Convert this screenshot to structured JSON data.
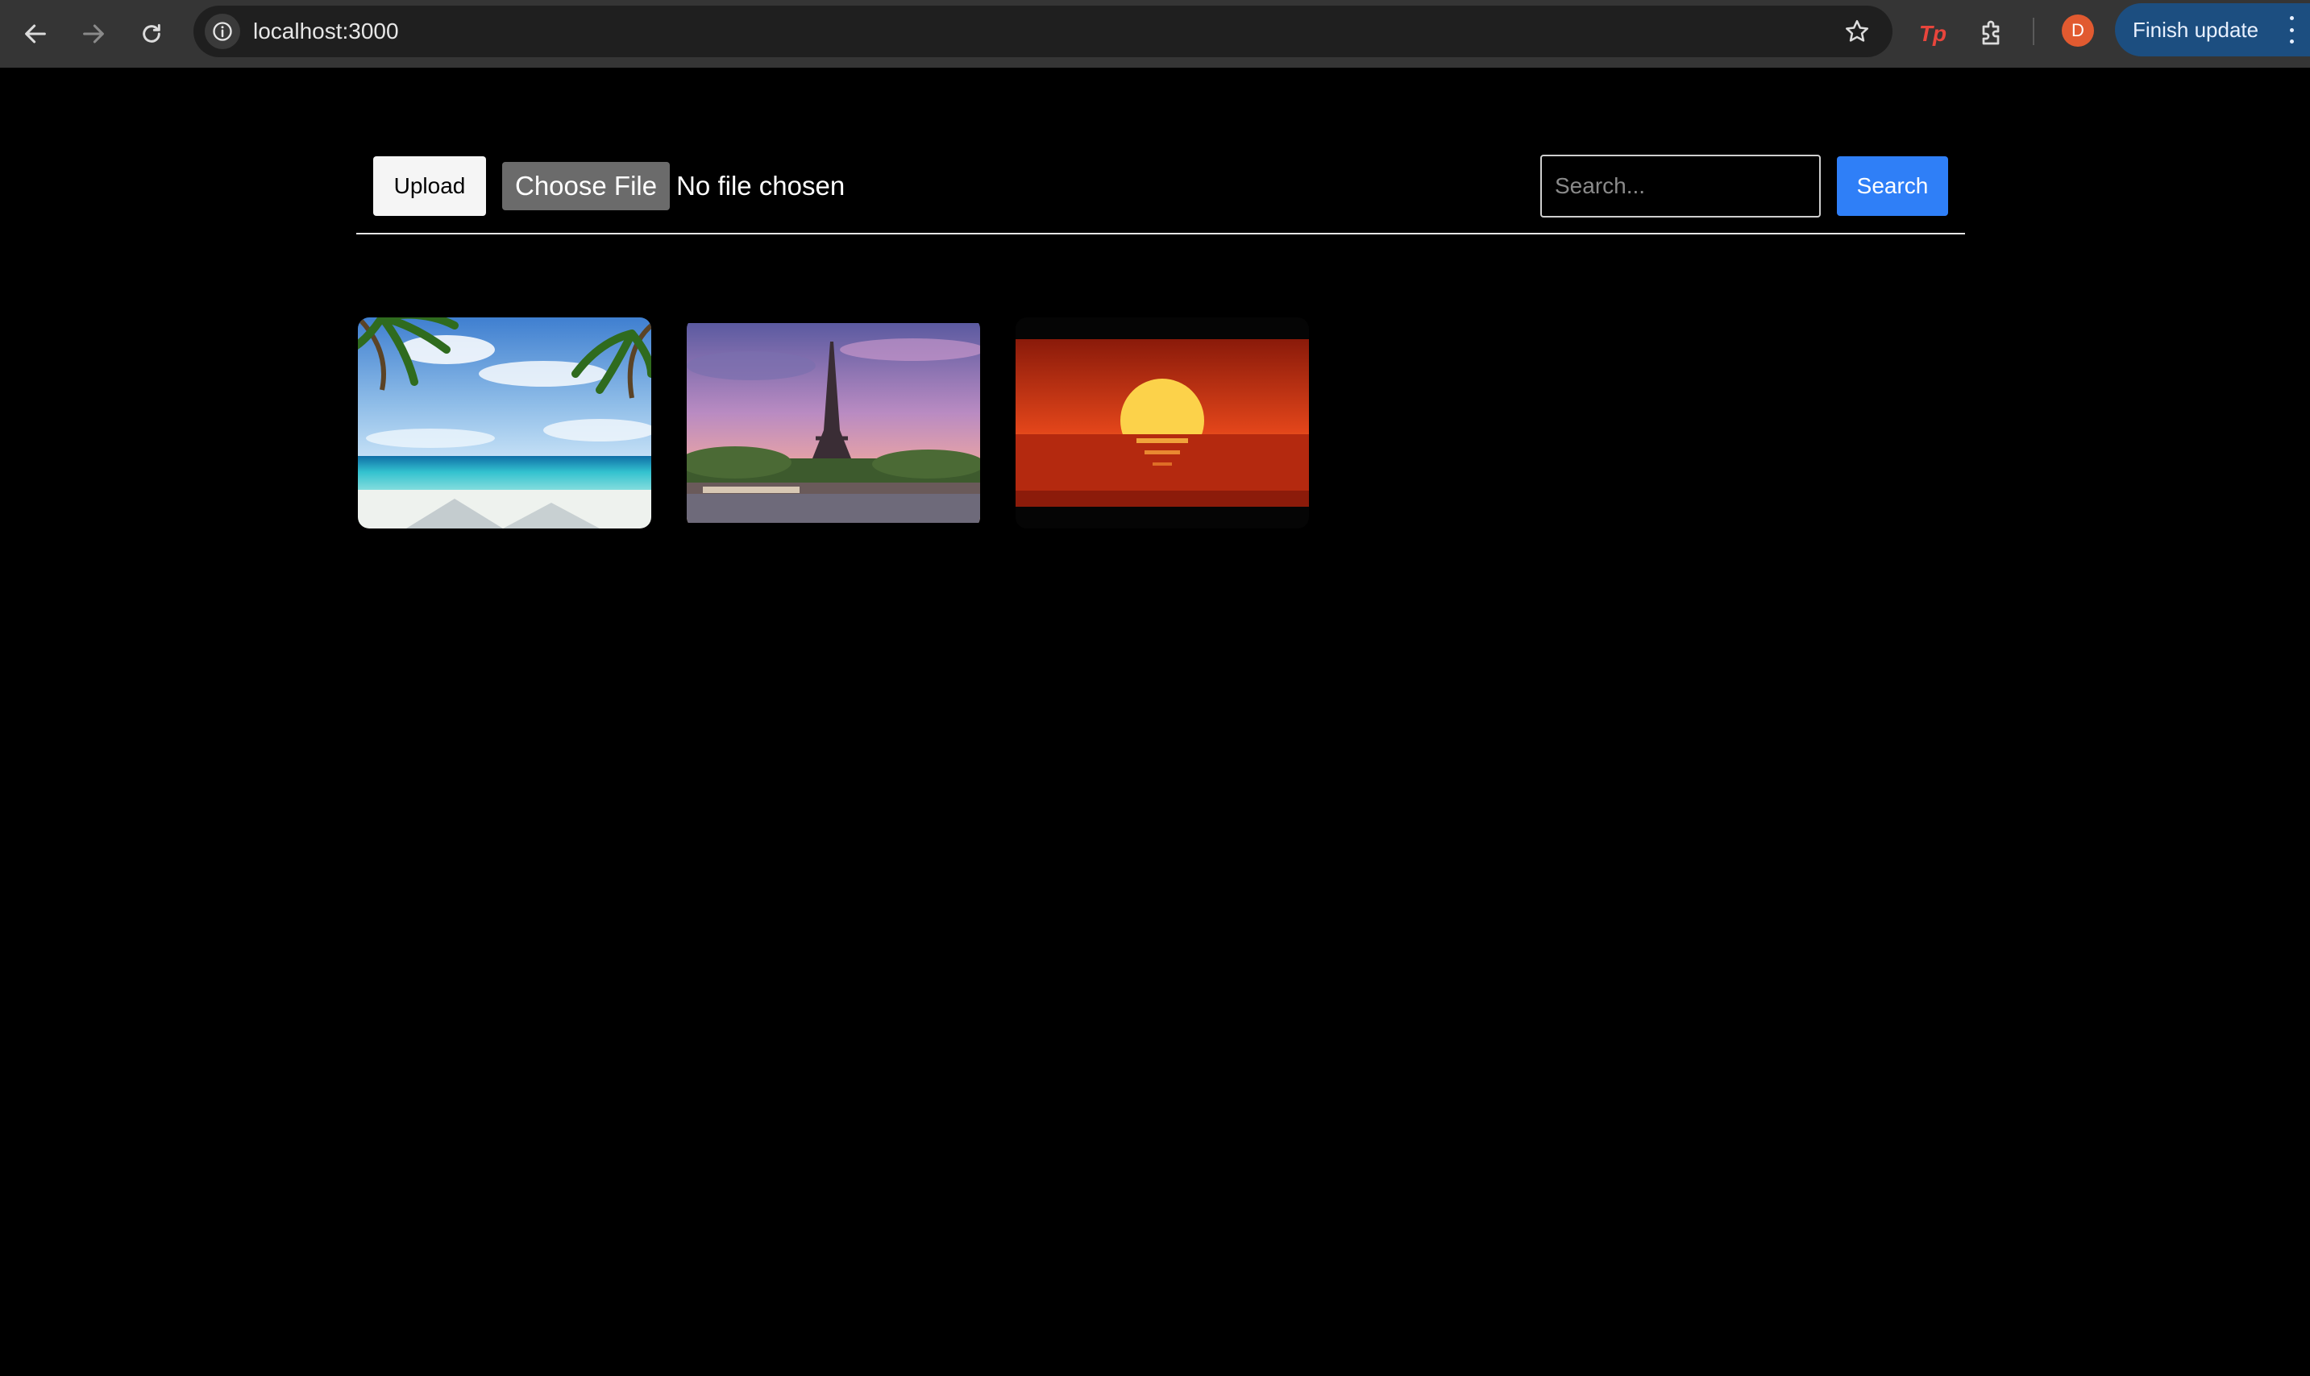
{
  "browser": {
    "url": "localhost:3000",
    "profile_initial": "D",
    "finish_update_label": "Finish update",
    "icons": {
      "back": "arrow-left-icon",
      "forward": "arrow-right-icon",
      "reload": "reload-icon",
      "site_info": "info-icon",
      "bookmark": "star-icon",
      "extension_tp": "tp-extension-icon",
      "extensions": "puzzle-icon",
      "menu": "kebab-menu-icon"
    },
    "tp_label": "Tp"
  },
  "toolbar": {
    "upload_label": "Upload",
    "choose_file_label": "Choose File",
    "file_status": "No file chosen",
    "search_placeholder": "Search...",
    "search_value": "",
    "search_label": "Search"
  },
  "gallery": {
    "images": [
      {
        "subject": "tropical beach with palm trees"
      },
      {
        "subject": "Eiffel Tower at sunset over the Seine"
      },
      {
        "subject": "red sunset over the sea"
      }
    ]
  },
  "colors": {
    "page_background": "#000000",
    "search_button": "#2f7ff7",
    "finish_update": "#1c4e80",
    "avatar": "#e15a30"
  }
}
